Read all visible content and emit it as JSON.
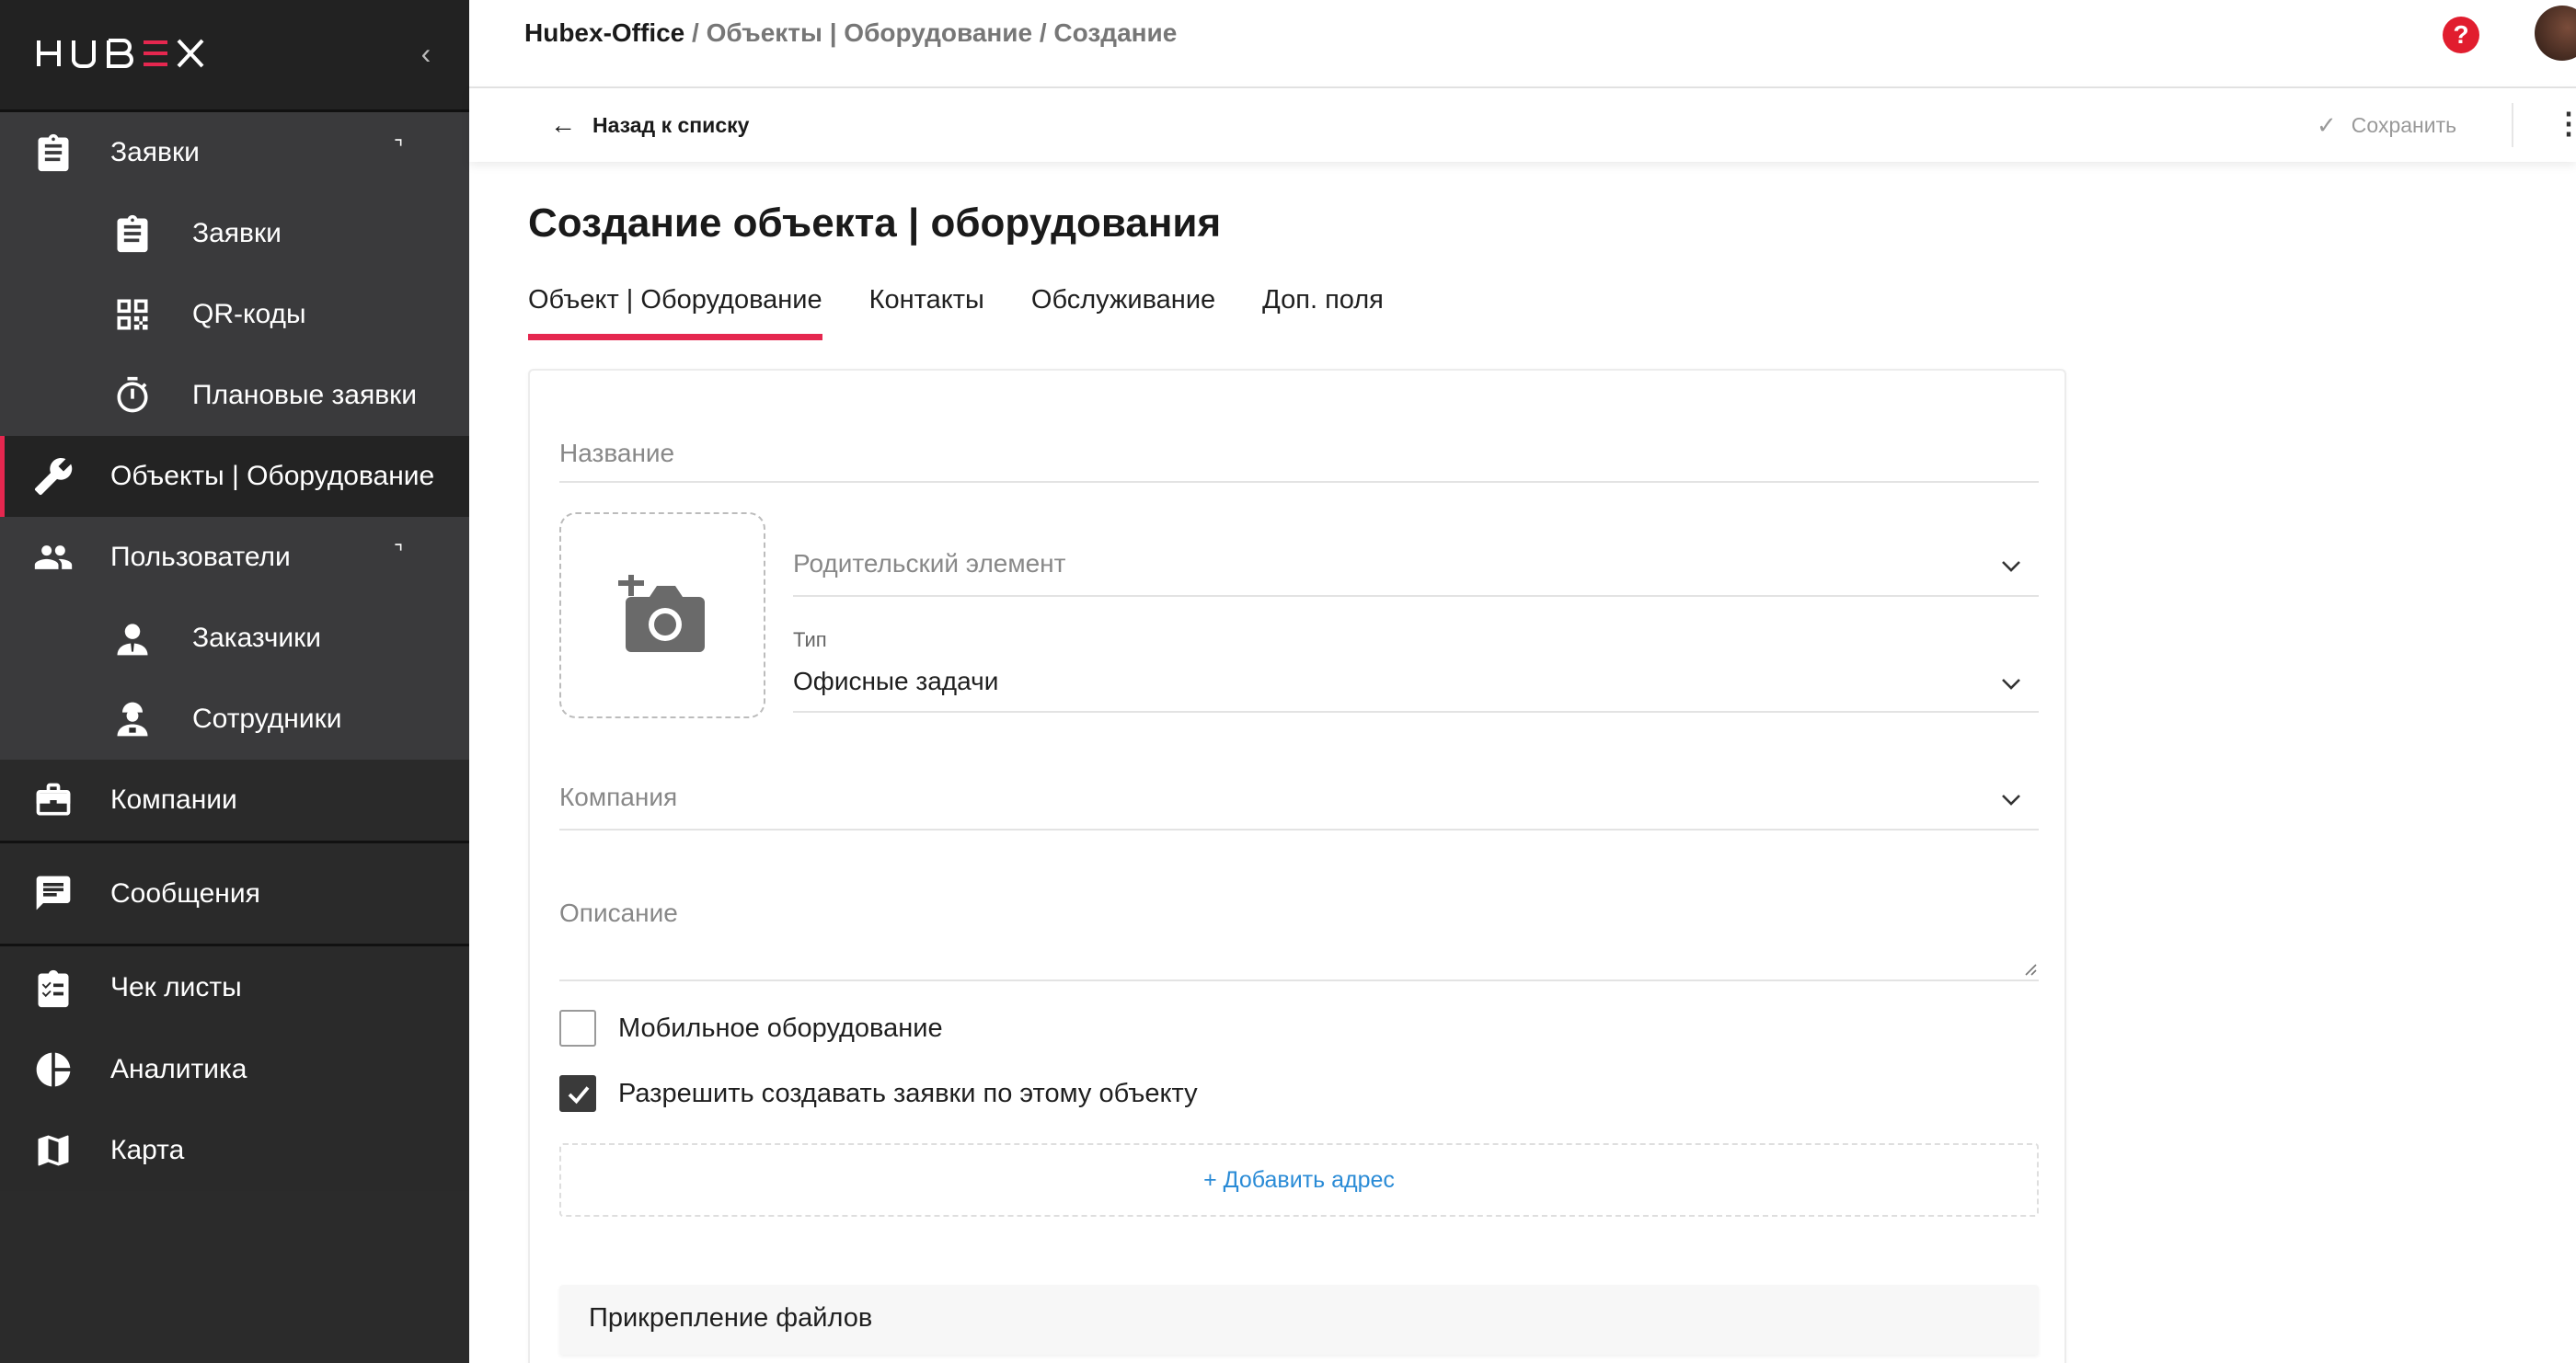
{
  "app": {
    "logo_text": "HUBEX",
    "collapse_glyph": "‹"
  },
  "sidebar": {
    "items": [
      {
        "label": "Заявки",
        "icon": "clipboard-icon",
        "expandable": true
      },
      {
        "label": "Заявки",
        "icon": "clipboard-icon",
        "sub": true
      },
      {
        "label": "QR-коды",
        "icon": "qr-code-icon",
        "sub": true
      },
      {
        "label": "Плановые заявки",
        "icon": "stopwatch-icon",
        "sub": true
      },
      {
        "label": "Объекты | Оборудование",
        "icon": "wrench-icon",
        "active": true
      },
      {
        "label": "Пользователи",
        "icon": "users-icon",
        "expandable": true
      },
      {
        "label": "Заказчики",
        "icon": "customer-icon",
        "sub": true
      },
      {
        "label": "Сотрудники",
        "icon": "employee-icon",
        "sub": true
      },
      {
        "label": "Компании",
        "icon": "briefcase-icon"
      },
      {
        "label": "Сообщения",
        "icon": "message-icon"
      },
      {
        "label": "Чек листы",
        "icon": "checklist-icon"
      },
      {
        "label": "Аналитика",
        "icon": "pie-chart-icon"
      },
      {
        "label": "Карта",
        "icon": "map-icon"
      }
    ],
    "expand_glyph": "⌝"
  },
  "header": {
    "breadcrumb_root": "Hubex-Office",
    "breadcrumb_rest": " / Объекты | Оборудование / Создание",
    "breadcrumb_sep": " / ",
    "help_glyph": "?"
  },
  "actionbar": {
    "back_arrow": "←",
    "back_label": "Назад к списку",
    "save_check": "✓",
    "save_label": "Сохранить",
    "more_glyph": "⋮"
  },
  "page": {
    "title": "Создание объекта | оборудования",
    "tabs": [
      {
        "label": "Объект | Оборудование",
        "active": true
      },
      {
        "label": "Контакты"
      },
      {
        "label": "Обслуживание"
      },
      {
        "label": "Доп. поля"
      }
    ]
  },
  "form": {
    "name_placeholder": "Название",
    "parent_placeholder": "Родительский элемент",
    "type_label": "Тип",
    "type_value": "Офисные задачи",
    "company_placeholder": "Компания",
    "description_placeholder": "Описание",
    "mobile_label": "Мобильное оборудование",
    "mobile_checked": false,
    "allow_requests_label": "Разрешить создавать заявки по этому объекту",
    "allow_requests_checked": true,
    "add_address_label": "+ Добавить адрес",
    "files_label": "Прикрепление файлов"
  },
  "colors": {
    "accent": "#e5274f",
    "sidebar_bg": "#2b2b2b",
    "link": "#2a8bd6"
  }
}
